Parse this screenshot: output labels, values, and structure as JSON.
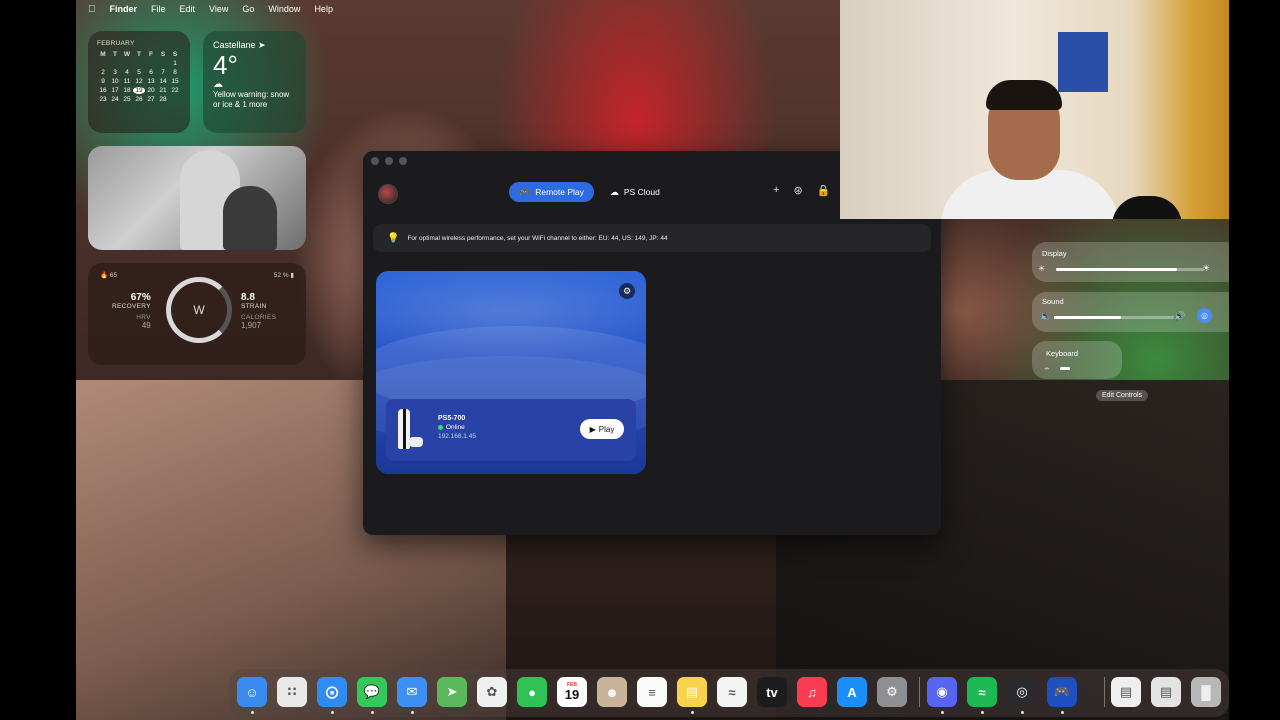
{
  "menubar": {
    "apple": "",
    "app": "Finder",
    "items": [
      "File",
      "Edit",
      "View",
      "Go",
      "Window",
      "Help"
    ]
  },
  "widgets": {
    "calendar": {
      "month": "FEBRUARY",
      "headers": [
        "M",
        "T",
        "W",
        "T",
        "F",
        "S",
        "S"
      ],
      "days": [
        "",
        "",
        "",
        "",
        "",
        "",
        "1",
        "2",
        "3",
        "4",
        "5",
        "6",
        "7",
        "8",
        "9",
        "10",
        "11",
        "12",
        "13",
        "14",
        "15",
        "16",
        "17",
        "18",
        "19",
        "20",
        "21",
        "22",
        "23",
        "24",
        "25",
        "26",
        "27",
        "28",
        ""
      ],
      "today": "19"
    },
    "weather": {
      "city": "Castellane",
      "temp": "4°",
      "message": "Yellow warning: snow or ice & 1 more"
    },
    "whoop": {
      "flame": "65",
      "battery": "52 %",
      "recovery_value": "67%",
      "recovery_label": "RECOVERY",
      "hrv_label": "HRV",
      "hrv_value": "49",
      "ring_label": "W",
      "strain_value": "8.8",
      "strain_label": "STRAIN",
      "calories_label": "CALORIES",
      "calories_value": "1,907"
    }
  },
  "app": {
    "tabs": [
      {
        "label": "Remote Play",
        "icon": "gamepad-icon",
        "active": true
      },
      {
        "label": "PS Cloud",
        "icon": "cloud-icon",
        "active": false
      }
    ],
    "tools": [
      "add-icon",
      "signal-icon",
      "lock-icon"
    ],
    "banner": "For optimal wireless performance, set your WiFi channel to either: EU: 44, US: 149, JP: 44",
    "console": {
      "name": "PS5-700",
      "status": "Online",
      "ip": "192.168.1.45",
      "play": "Play"
    }
  },
  "control_center": {
    "display_label": "Display",
    "display_level": 0.82,
    "sound_label": "Sound",
    "sound_level": 0.56,
    "keyboard_label": "Keyboard",
    "edit_label": "Edit Controls"
  },
  "dock": {
    "items": [
      {
        "name": "finder",
        "color": "#3a8bf0"
      },
      {
        "name": "launchpad",
        "color": "#e8e8e8"
      },
      {
        "name": "safari",
        "color": "#2f8cf2"
      },
      {
        "name": "messages",
        "color": "#34c759"
      },
      {
        "name": "mail",
        "color": "#3d8ff3"
      },
      {
        "name": "maps",
        "color": "#5cb85c"
      },
      {
        "name": "photos",
        "color": "#f0f0f0"
      },
      {
        "name": "facetime",
        "color": "#30c255"
      },
      {
        "name": "calendar",
        "color": "#ffffff",
        "text": "19",
        "month": "FEB"
      },
      {
        "name": "contacts",
        "color": "#c9b49a"
      },
      {
        "name": "reminders",
        "color": "#fafafa"
      },
      {
        "name": "notes",
        "color": "#f7d24a"
      },
      {
        "name": "freeform",
        "color": "#f4f4f4"
      },
      {
        "name": "apple-tv",
        "color": "#1c1c1e",
        "text": "tv"
      },
      {
        "name": "music",
        "color": "#fa3c52"
      },
      {
        "name": "app-store",
        "color": "#1c8ef9"
      },
      {
        "name": "system-settings",
        "color": "#8e8e93"
      },
      {
        "name": "discord",
        "color": "#5865f2"
      },
      {
        "name": "spotify",
        "color": "#1db954"
      },
      {
        "name": "screen-capture",
        "color": "#2b2b2e"
      },
      {
        "name": "ps-remote-play",
        "color": "#1f4fc2"
      },
      {
        "name": "document-1",
        "color": "#efefef"
      },
      {
        "name": "document-2",
        "color": "#e3e3e3"
      },
      {
        "name": "trash",
        "color": "#b8b8b8"
      }
    ]
  }
}
